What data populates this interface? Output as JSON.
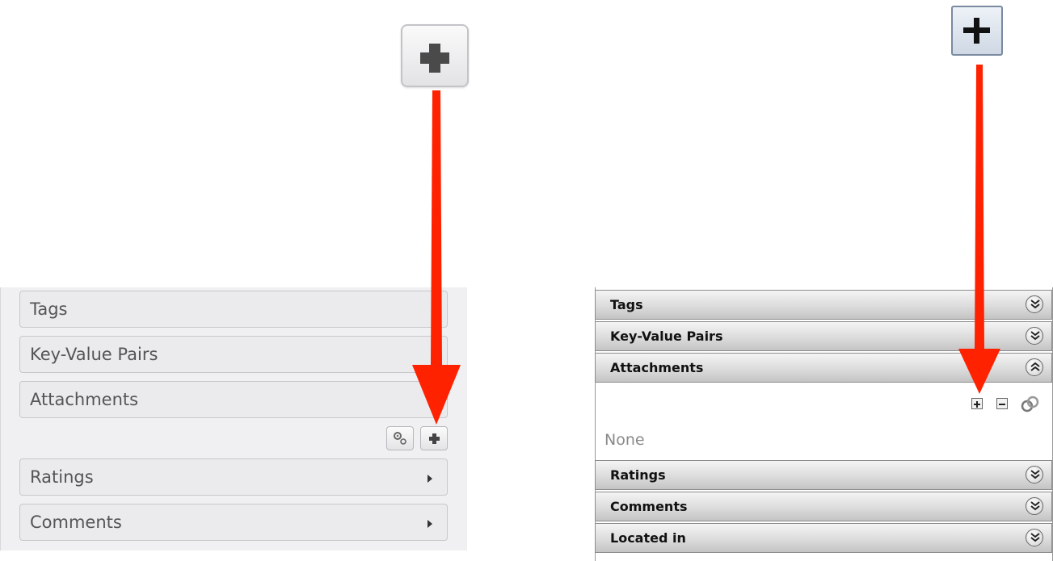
{
  "left": {
    "sections": [
      {
        "label": "Tags"
      },
      {
        "label": "Key-Value Pairs"
      },
      {
        "label": "Attachments"
      },
      {
        "label": "Ratings"
      },
      {
        "label": "Comments"
      }
    ],
    "attachment_buttons": {
      "settings_icon": "gears-icon",
      "add_icon": "plus-icon"
    },
    "expand_icon": "triangle-right-icon"
  },
  "right": {
    "sections": [
      {
        "label": "Tags",
        "state": "collapsed"
      },
      {
        "label": "Key-Value Pairs",
        "state": "collapsed"
      },
      {
        "label": "Attachments",
        "state": "expanded"
      },
      {
        "label": "Ratings",
        "state": "collapsed"
      },
      {
        "label": "Comments",
        "state": "collapsed"
      },
      {
        "label": "Located in",
        "state": "collapsed"
      }
    ],
    "attachments_empty_text": "None",
    "attachment_tools": [
      "add-icon",
      "remove-icon",
      "link-icon"
    ]
  },
  "colors": {
    "arrow": "#ff2200",
    "left_panel_bg": "#f0f0f2",
    "right_header_bg": "#d6d6d6"
  }
}
